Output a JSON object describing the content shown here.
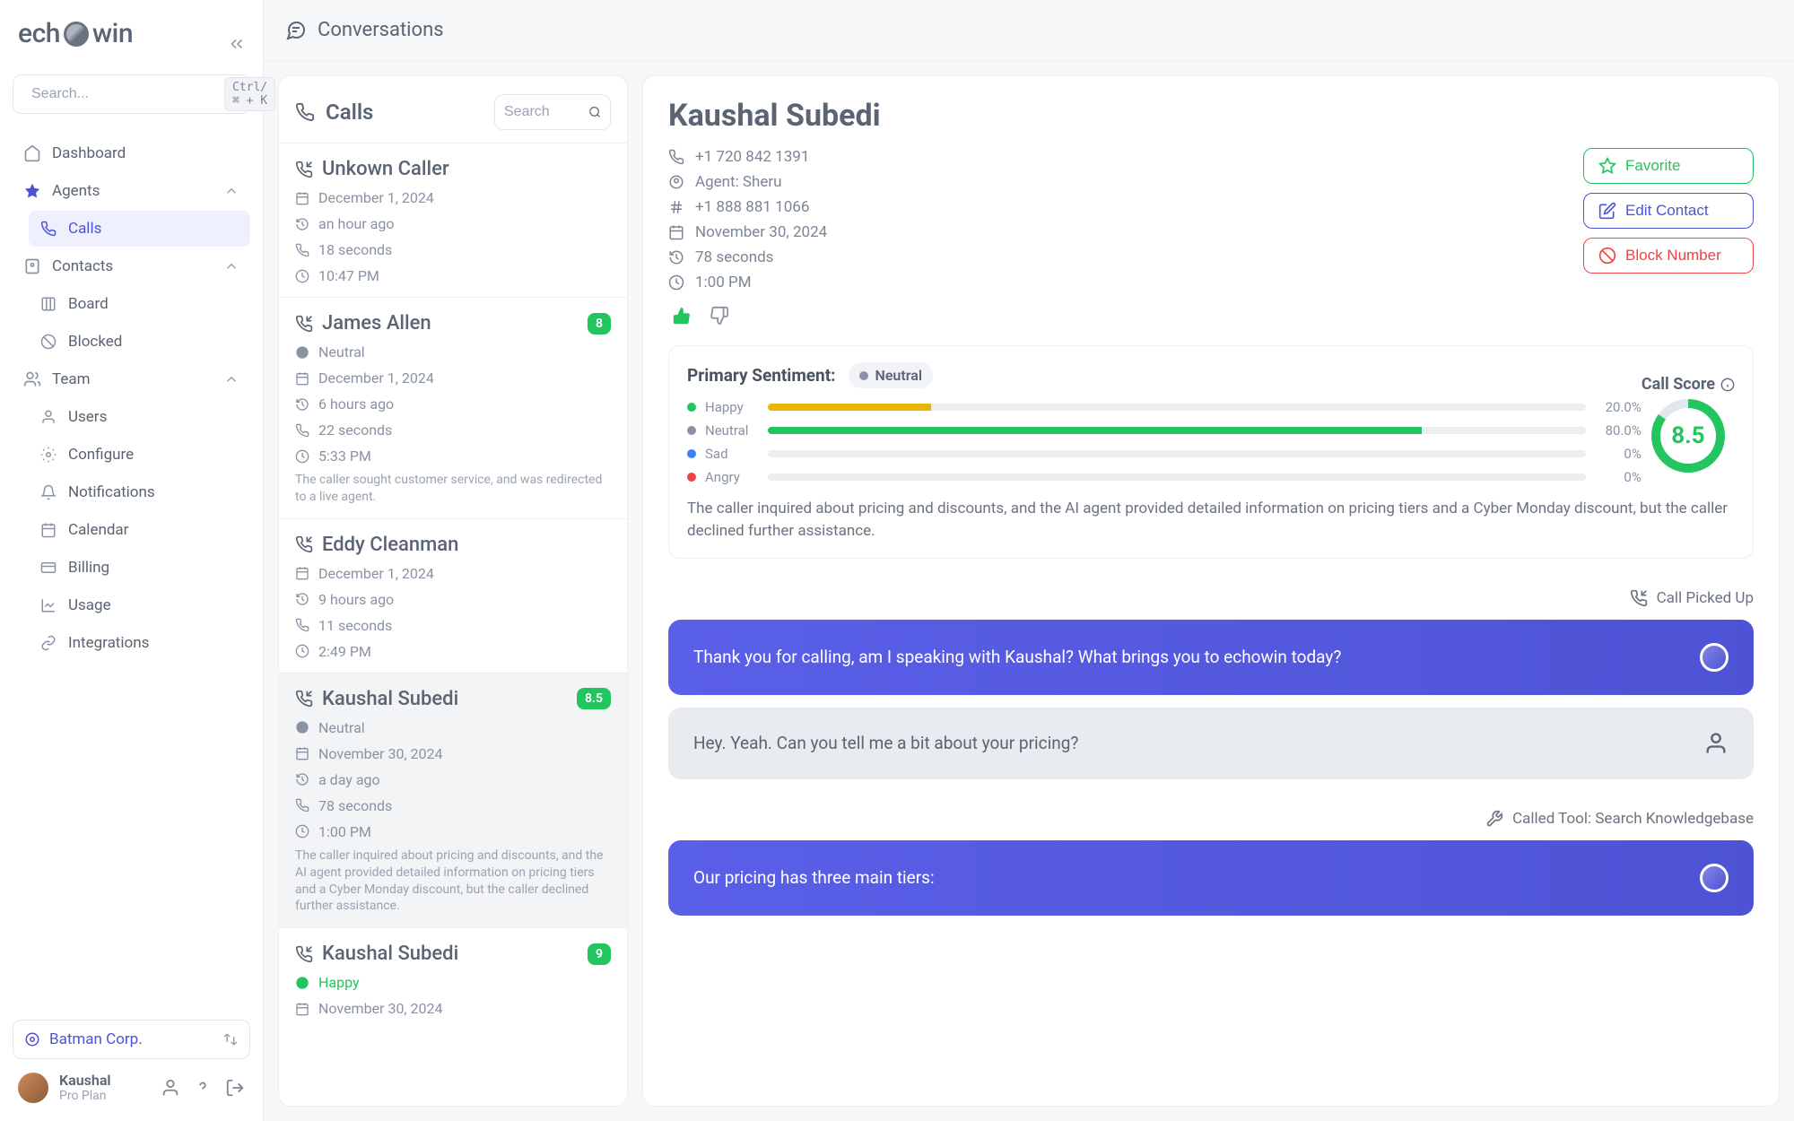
{
  "logo": {
    "pre": "ech",
    "post": "win"
  },
  "search": {
    "placeholder": "Search...",
    "kbd": "Ctrl/⌘ + K"
  },
  "nav": {
    "dashboard": "Dashboard",
    "agents": "Agents",
    "calls": "Calls",
    "contacts": "Contacts",
    "board": "Board",
    "blocked": "Blocked",
    "team": "Team",
    "users": "Users",
    "configure": "Configure",
    "notifications": "Notifications",
    "calendar": "Calendar",
    "billing": "Billing",
    "usage": "Usage",
    "integrations": "Integrations"
  },
  "org": "Batman Corp.",
  "user": {
    "name": "Kaushal",
    "plan": "Pro Plan"
  },
  "topbar": {
    "title": "Conversations"
  },
  "calls": {
    "title": "Calls",
    "search_ph": "Search",
    "items": [
      {
        "name": "Unkown Caller",
        "date": "December 1, 2024",
        "ago": "an hour ago",
        "dur": "18 seconds",
        "time": "10:47 PM",
        "sentiment": null,
        "badge": null,
        "summary": null
      },
      {
        "name": "James Allen",
        "date": "December 1, 2024",
        "ago": "6 hours ago",
        "dur": "22 seconds",
        "time": "5:33 PM",
        "sentiment": "Neutral",
        "badge": "8",
        "summary": "The caller sought customer service, and was redirected to a live agent."
      },
      {
        "name": "Eddy Cleanman",
        "date": "December 1, 2024",
        "ago": "9 hours ago",
        "dur": "11 seconds",
        "time": "2:49 PM",
        "sentiment": null,
        "badge": null,
        "summary": null
      },
      {
        "name": "Kaushal Subedi",
        "date": "November 30, 2024",
        "ago": "a day ago",
        "dur": "78 seconds",
        "time": "1:00 PM",
        "sentiment": "Neutral",
        "badge": "8.5",
        "summary": "The caller inquired about pricing and discounts, and the AI agent provided detailed information on pricing tiers and a Cyber Monday discount, but the caller declined further assistance."
      },
      {
        "name": "Kaushal Subedi",
        "date": "November 30, 2024",
        "ago": null,
        "dur": null,
        "time": null,
        "sentiment": "Happy",
        "badge": "9",
        "summary": null
      }
    ]
  },
  "detail": {
    "name": "Kaushal Subedi",
    "phone": "+1 720 842 1391",
    "agent": "Agent: Sheru",
    "hash": "+1 888 881 1066",
    "date": "November 30, 2024",
    "dur": "78 seconds",
    "time": "1:00 PM",
    "actions": {
      "fav": "Favorite",
      "edit": "Edit Contact",
      "block": "Block Number"
    },
    "sentiment": {
      "title": "Primary Sentiment:",
      "primary": "Neutral",
      "rows": [
        {
          "name": "Happy",
          "pct": "20.0%",
          "dot": "#22c55e",
          "bar": "#eab308",
          "w": 20
        },
        {
          "name": "Neutral",
          "pct": "80.0%",
          "dot": "#8a93a3",
          "bar": "#22c55e",
          "w": 80
        },
        {
          "name": "Sad",
          "pct": "0%",
          "dot": "#3b82f6",
          "bar": "#3b82f6",
          "w": 0
        },
        {
          "name": "Angry",
          "pct": "0%",
          "dot": "#ef4444",
          "bar": "#ef4444",
          "w": 0
        }
      ],
      "score_label": "Call Score",
      "score": "8.5"
    },
    "summary": "The caller inquired about pricing and discounts, and the AI agent provided detailed information on pricing tiers and a Cyber Monday discount, but the caller declined further assistance.",
    "status1": "Call Picked Up",
    "msg1": "Thank you for calling, am I speaking with Kaushal? What brings you to echowin today?",
    "msg2": "Hey. Yeah. Can you tell me a bit about your pricing?",
    "status2": "Called Tool: Search Knowledgebase",
    "msg3": "Our pricing has three main tiers:"
  }
}
